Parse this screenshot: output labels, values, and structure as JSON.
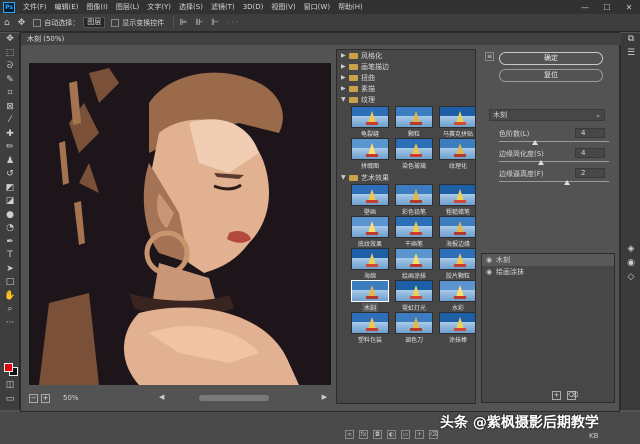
{
  "menubar": {
    "logo": "Ps",
    "items": [
      "文件(F)",
      "编辑(E)",
      "图像(I)",
      "图层(L)",
      "文字(Y)",
      "选择(S)",
      "滤镜(T)",
      "3D(D)",
      "视图(V)",
      "窗口(W)",
      "帮助(H)"
    ],
    "win_min": "—",
    "win_max": "☐",
    "win_close": "✕"
  },
  "optbar": {
    "auto_select_label": "自动选择：",
    "auto_select_value": "图层",
    "show_transform_label": "显示变换控件",
    "more": "···"
  },
  "dialog": {
    "title": "木刻 (50%)",
    "zoom": "50%",
    "zoom_minus": "−",
    "zoom_plus": "+"
  },
  "tree": {
    "categories_collapsed": [
      "风格化",
      "画笔描边",
      "扭曲",
      "素描"
    ],
    "texture": {
      "name": "纹理",
      "filters": [
        "龟裂缝",
        "颗粒",
        "马赛克拼贴",
        "拼缀图",
        "染色玻璃",
        "纹理化"
      ]
    },
    "artistic": {
      "name": "艺术效果",
      "filters": [
        "壁画",
        "彩色铅笔",
        "粗糙蜡笔",
        "底纹效果",
        "干画笔",
        "海报边缘",
        "海绵",
        "绘画涂抹",
        "胶片颗粒",
        "木刻",
        "霓虹灯光",
        "水彩",
        "塑料包装",
        "调色刀",
        "涂抹棒"
      ],
      "selected_index": 9
    }
  },
  "settings": {
    "ok_label": "确定",
    "reset_label": "复位",
    "filter_name": "木刻",
    "params": [
      {
        "label": "色阶数(L)",
        "value": "4",
        "fraction": 0.33
      },
      {
        "label": "边缘简化度(S)",
        "value": "4",
        "fraction": 0.38
      },
      {
        "label": "边缘逼真度(F)",
        "value": "2",
        "fraction": 0.62
      }
    ]
  },
  "layers": {
    "items": [
      "木刻",
      "绘画涂抹"
    ],
    "selected_index": 0
  },
  "status": {
    "kb": "KB",
    "watermark": "头条 @紫枫摄影后期教学"
  },
  "colors": {
    "foreground": "#e3000f",
    "background": "#111111",
    "skin": "#e2b192",
    "hair": "#9a6a4a",
    "canvas_bg": "#1e151a"
  }
}
